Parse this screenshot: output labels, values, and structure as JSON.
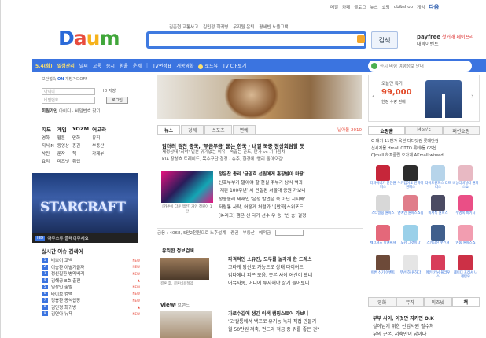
{
  "util": [
    "메일",
    "카페",
    "블로그",
    "뉴스",
    "쇼핑",
    "db&shop",
    "게임"
  ],
  "util_brand": "다음",
  "logo": "Daum",
  "keywords": [
    "김준현 교통사고",
    "김민정 희귀병",
    "우지원 은퇴",
    "평세빈 뇨졸고백"
  ],
  "search": {
    "button": "검색"
  },
  "payfree": {
    "brand": "payfree",
    "l1": "첫거래 페이프리",
    "l2": "대박이벤트"
  },
  "nav": {
    "date": "5.4(화)",
    "date_label": "일정관리",
    "items": [
      "날씨",
      "교통",
      "증시",
      "환율",
      "운세"
    ],
    "tv": "TV편성표",
    "dev": "개봉영화",
    "road": "로드뷰",
    "tvpot": "TV C F보기"
  },
  "nav_right": "한지 비행 여행정보 안내",
  "login": {
    "hint": "보안접속",
    "hint_on": "ON",
    "hint_off": "개방가드OFF",
    "id_ph": "아이디",
    "pw_ph": "비밀번호",
    "save": "ID 저장",
    "btn": "로그인",
    "join_b": "회원가입",
    "join": "아이디 · 비밀번호 찾기"
  },
  "ad": {
    "t1": "오늘만 특가",
    "t2": "99,000",
    "t3": "한정 수량 판매"
  },
  "dir": [
    [
      "지도",
      "게임",
      "YOZM",
      "어고라"
    ],
    [
      "영화",
      "웹툰",
      "만화",
      "뮤직"
    ],
    [
      "지식iN",
      "동영상",
      "증권",
      "부동산"
    ],
    [
      "사전",
      "문자",
      "책",
      "가계부"
    ],
    [
      "요리",
      "미즈넷",
      "취업",
      ""
    ]
  ],
  "sc_banner": {
    "title": "STARCRAFT",
    "hd": "HD",
    "caption": "아주스튜 플레이주세요"
  },
  "realtime": {
    "head": "실시간 이슈 검색어",
    "items": [
      "비보이 고백",
      "이승환 이별기글자",
      "정신질환 병역비리",
      "김해공 8호 출전",
      "임창민 출발",
      "바이브 컴백",
      "정봉환 공식입장",
      "김민정 희귀병",
      "김연아 뉴욕"
    ]
  },
  "news_tabs": [
    "뉴스",
    "경제",
    "스포츠",
    "연예"
  ],
  "news_ex": "날아올 2010",
  "headlines": [
    "암더러 겸찬 중국, '부금부금' 묻는 한국 · 내일 북중 정상회담할 듯",
    "재정상태 '최악' 일본 위기없는 이유 · 속끓는 관도, 판가 vs 기다림차",
    "KIA 장성호 트레이드, 목수구단 결정 · 슈주, 한경에 '빨리 돌아오길'"
  ],
  "feature": {
    "img_cap": "[카툰이 다운 맥션] 거인 정원이 1탄",
    "lines": [
      "정운찬 총리 '금양호 선원에게 훈장받아 마땅'",
      "신호부부가 말아야 할 현실 주부가 상식 벽과",
      "'계판 100주년' 세 단절된 서울대 공원 가보니",
      "청송볼레 제재인 '은정 발언은 속 아닌 지지해'",
      "저렴통 사탁, 어떻게 처럼가 ' [만화]스위포드",
      "[K-리그] 챔은 선 다기 선수 우 승, '빈 승' 결정"
    ]
  },
  "meta": {
    "text1": "금융 : 4068, 5만2천원으로 노후설계",
    "text2": "증권 · 부동산 · 예적금"
  },
  "info": {
    "head": "유익한 정보검색",
    "cap": "결혼 후, 결혼비용절약",
    "lines": [
      "파격적인 소유진, 모두를 놀라게 한 드레스",
      "그라게 당신도 가능으로 상태 다이어트",
      "김다에나 피곤 모음, 못본 사이 여신이 됐네",
      "어뮤자동, 어디에 투자해야 잘기 들어보니"
    ]
  },
  "view": {
    "head": "view",
    "head_sub": "/ 브랜드",
    "lines": [
      "가로수길에 생긴 이색 캠핑스토어 가보니",
      "'오'칼통에서 백프로 유기농 녹차 직접 만들기",
      "월 50만원 저축, 펀드와 적금 중 뭐를 좋은 건?"
    ]
  },
  "shop_tabs": [
    "쇼핑홈",
    "Men's",
    "패션쇼핑"
  ],
  "shop_links": [
    "G 패기 11번가 옥션 다다닷컴 롯데닷컴",
    "신세계몰 Hmall OTTO 롯데i몰 GS샵",
    "CJmall 하프클럽 오가게 AKmall wizwid"
  ],
  "goods": [
    {
      "cap": "디자이너가 만든원피스",
      "color": "#c6263a"
    },
    {
      "cap": "누가입어도 반하다원피스",
      "color": "#2d2d2d"
    },
    {
      "cap": "타이트원피스 리프리스",
      "color": "#b6d4ea"
    },
    {
      "cap": "바닐라바닐라 원피스쇼",
      "color": "#e8b9c3"
    },
    {
      "cap": "스타일링 원피스",
      "color": "#d8d8d8"
    },
    {
      "cap": "연예인 원피스쇼핑",
      "color": "#e07d8a"
    },
    {
      "cap": "비서룩 원피스",
      "color": "#4b4b63"
    },
    {
      "cap": "수영복 비키니",
      "color": "#ea4f86"
    },
    {
      "cap": "체크셔츠 이엔씨셔",
      "color": "#e4687a"
    },
    {
      "cap": "오감 그것이다",
      "color": "#9ad0e9"
    },
    {
      "cap": "스키니진 웃긴셔",
      "color": "#405f8c"
    },
    {
      "cap": "명품 원피스쇼",
      "color": "#f29db0"
    },
    {
      "cap": "이번 신기 이벤트",
      "color": "#6d4a39"
    },
    {
      "cap": "무선 하 원하다",
      "color": "#e5e5e5"
    },
    {
      "cap": "메인 키님 블라우스",
      "color": "#d83d5a"
    },
    {
      "cap": "레이디 프레셔 나렌탄우",
      "color": "#cc3046"
    }
  ],
  "shop_tabs2": [
    "영화",
    "뮤직",
    "미즈넷",
    "책"
  ],
  "shop_bottom": [
    "부부 사이, 이것만 지키면 O.K",
    "살아남기 위한 선입사원 필수처",
    "부의 근본, 저축만이 답이다"
  ]
}
